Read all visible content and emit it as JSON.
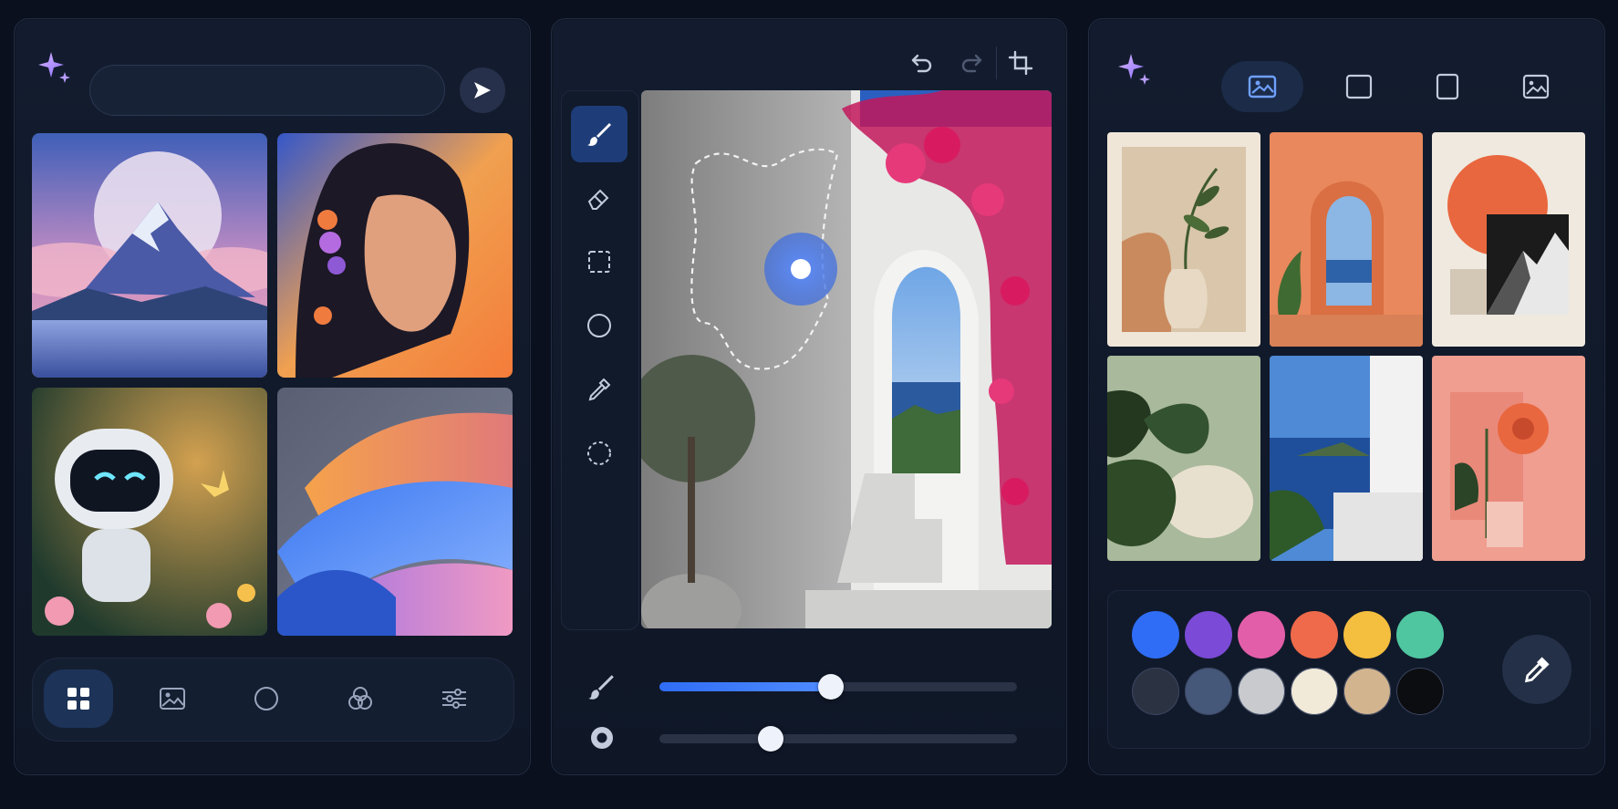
{
  "prompt": {
    "value": ""
  },
  "left_tabs": [
    {
      "name": "grid",
      "active": true
    },
    {
      "name": "image",
      "active": false
    },
    {
      "name": "circle",
      "active": false
    },
    {
      "name": "blend",
      "active": false
    },
    {
      "name": "adjust",
      "active": false
    }
  ],
  "editor": {
    "tools": [
      "brush",
      "eraser",
      "marquee-select",
      "ellipse",
      "eyedropper",
      "lasso"
    ],
    "active_tool": "brush",
    "brush_size": 0.48,
    "brush_hardness": 0.31
  },
  "formats": [
    "landscape",
    "square",
    "portrait",
    "photo"
  ],
  "active_format": "landscape",
  "palette": {
    "row1": [
      "#2f6df6",
      "#7b4ad6",
      "#e35ea8",
      "#ef6a4a",
      "#f4be3f",
      "#4fc6a0"
    ],
    "row2": [
      "#2b3242",
      "#45587a",
      "#c8cacd",
      "#f1ead9",
      "#d2b48f",
      "#0c0d10"
    ]
  }
}
